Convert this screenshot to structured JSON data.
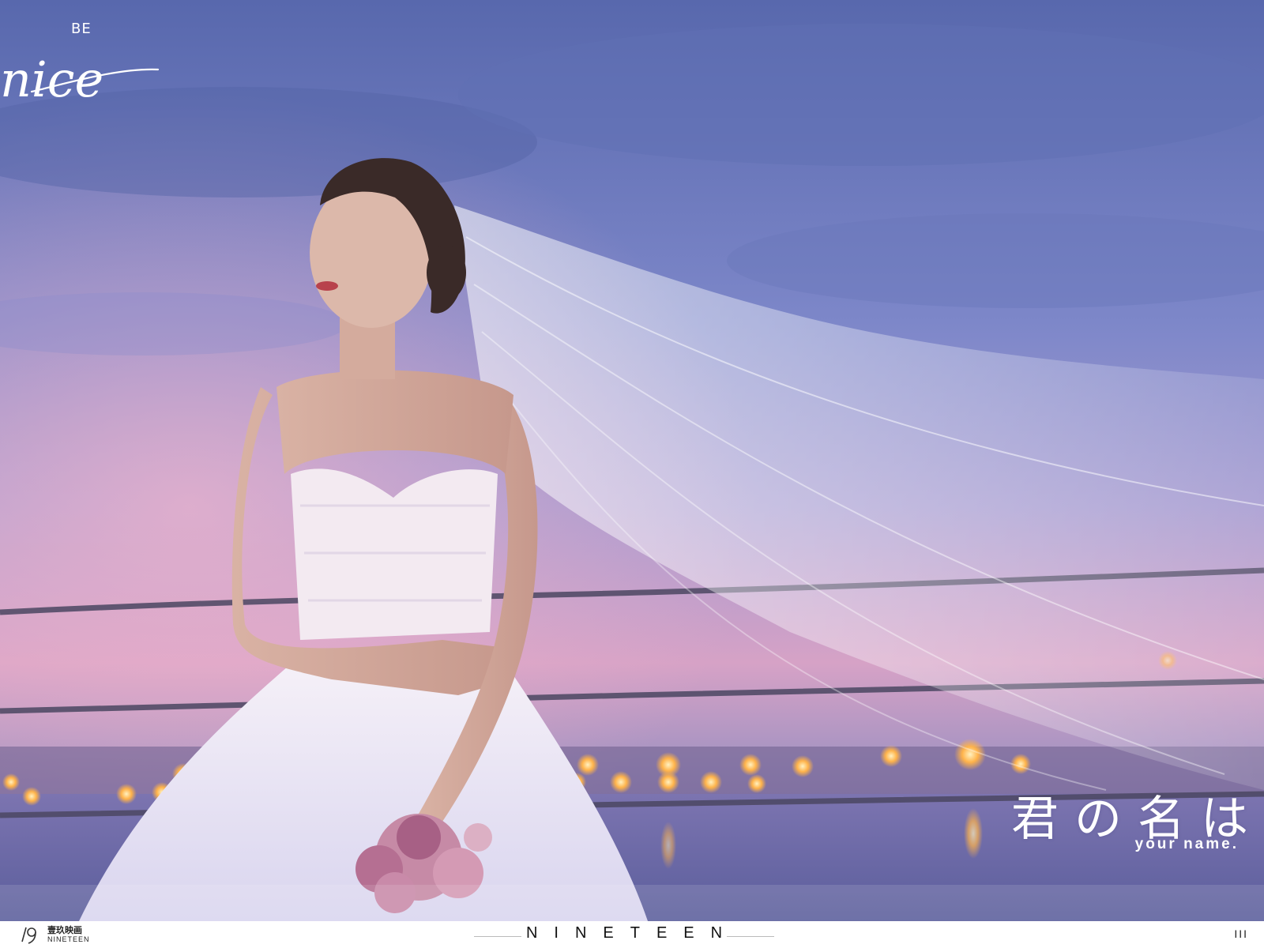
{
  "overlay": {
    "be_label": "BE",
    "nice_script": "nice",
    "jp_title": "君の名は",
    "en_subtitle": "your name."
  },
  "footer": {
    "logo_cn": "壹玖映画",
    "logo_en": "NINETEEN",
    "brand": "NINETEEN",
    "page_number": "III"
  },
  "colors": {
    "sky_top": "#5c6fb4",
    "sky_mid": "#8d84c8",
    "sky_glow": "#d99ac0",
    "water": "#6a6aa8",
    "lights": "#ffb34a"
  }
}
